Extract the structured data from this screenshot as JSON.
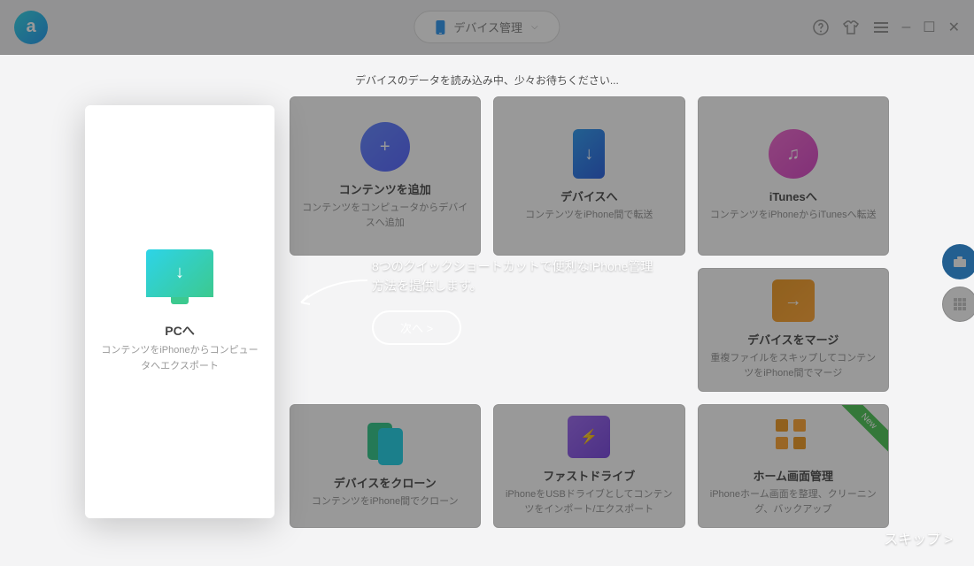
{
  "header": {
    "dropdown_label": "デバイス管理"
  },
  "loading_text": "デバイスのデータを読み込み中、少々お待ちください...",
  "highlight": {
    "title": "PCへ",
    "desc": "コンテンツをiPhoneからコンピュータへエクスポート"
  },
  "cards": {
    "add": {
      "title": "コンテンツを追加",
      "desc": "コンテンツをコンピュータからデバイスへ追加"
    },
    "device": {
      "title": "デバイスへ",
      "desc": "コンテンツをiPhone間で転送"
    },
    "itunes": {
      "title": "iTunesへ",
      "desc": "コンテンツをiPhoneからiTunesへ転送"
    },
    "merge": {
      "title": "デバイスをマージ",
      "desc": "重複ファイルをスキップしてコンテンツをiPhone間でマージ"
    },
    "clone": {
      "title": "デバイスをクローン",
      "desc": "コンテンツをiPhone間でクローン"
    },
    "fast": {
      "title": "ファストドライブ",
      "desc": "iPhoneをUSBドライブとしてコンテンツをインポート/エクスポート"
    },
    "home": {
      "title": "ホーム画面管理",
      "desc": "iPhoneホーム画面を整理、クリーニング、バックアップ"
    }
  },
  "onboard": {
    "text": "8つのクイックショートカットで便利なiPhone管理方法を提供します。",
    "next": "次へ >",
    "skip": "スキップ >"
  }
}
